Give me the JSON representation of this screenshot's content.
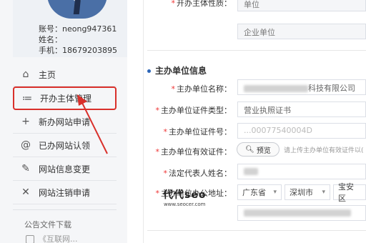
{
  "profile": {
    "account": "账号：neong947361",
    "name": "姓名：",
    "phone": "手机：18679203895"
  },
  "nav": {
    "items": [
      {
        "icon": "home-icon",
        "glyph": "⌂",
        "label": "主页"
      },
      {
        "icon": "list-icon",
        "glyph": "≔",
        "label": "开办主体管理"
      },
      {
        "icon": "plus-icon",
        "glyph": "+",
        "label": "新办网站申请"
      },
      {
        "icon": "at-icon",
        "glyph": "@",
        "label": "已办网站认领"
      },
      {
        "icon": "edit-icon",
        "glyph": "✎",
        "label": "网站信息变更"
      },
      {
        "icon": "close-icon",
        "glyph": "✕",
        "label": "网站注销申请"
      }
    ]
  },
  "announcements": {
    "title": "公告文件下载",
    "item": "《互联网..."
  },
  "form": {
    "top_label": "开办主体性质：",
    "top_value": "单位",
    "org_type": "企业单位",
    "section_title": "主办单位信息",
    "labels": {
      "org_name": "主办单位名称：",
      "cert_type": "主办单位证件类型：",
      "cert_no": "主办单位证件号：",
      "cert_valid": "主办单位有效证件：",
      "legal_rep": "法定代表人姓名：",
      "address": "主办单位办公地址："
    },
    "org_name_suffix": "科技有限公司",
    "cert_type_value": "营业执照证书",
    "cert_no_partial": "...00077540004D",
    "preview_label": "预览",
    "upload_hint": "请上传主办单位有效证件以(",
    "province": "广东省",
    "city": "深圳市",
    "district": "宝安区"
  },
  "watermark": {
    "title": "代代seo",
    "url": "www.seocer.com"
  },
  "colors": {
    "highlight": "#d9302b",
    "accent": "#2d66b8",
    "required": "#e33"
  }
}
